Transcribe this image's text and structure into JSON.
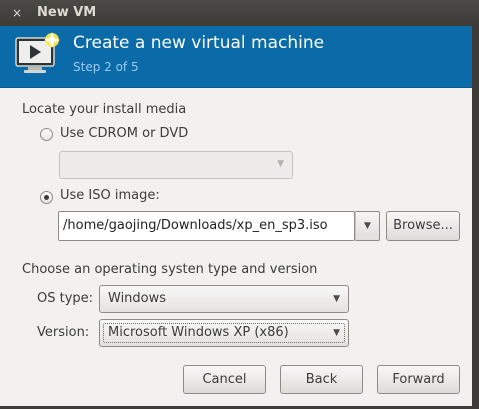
{
  "window": {
    "title": "New VM",
    "close_glyph": "×"
  },
  "header": {
    "icon": "virtual-machine-monitor-icon",
    "title": "Create a new virtual machine",
    "step": "Step 2 of 5"
  },
  "install_media": {
    "heading": "Locate your install media",
    "cdrom_option": {
      "label": "Use CDROM or DVD",
      "checked": false
    },
    "cdrom_combo": {
      "value": "",
      "disabled": true
    },
    "iso_option": {
      "label": "Use ISO image:",
      "checked": true
    },
    "iso_path": "/home/gaojing/Downloads/xp_en_sp3.iso",
    "browse_label": "Browse..."
  },
  "os_section": {
    "heading": "Choose an operating systen type and version",
    "os_type_label": "OS type:",
    "os_type_value": "Windows",
    "version_label": "Version:",
    "version_value": "Microsoft Windows XP (x86)"
  },
  "footer": {
    "cancel_label": "Cancel",
    "back_label": "Back",
    "forward_label": "Forward"
  },
  "colors": {
    "header_bg": "#0b6aa8",
    "header_step": "#9ccbf0",
    "titlebar_bg": "#3c3b37",
    "dialog_bg": "#f2f1f0"
  }
}
